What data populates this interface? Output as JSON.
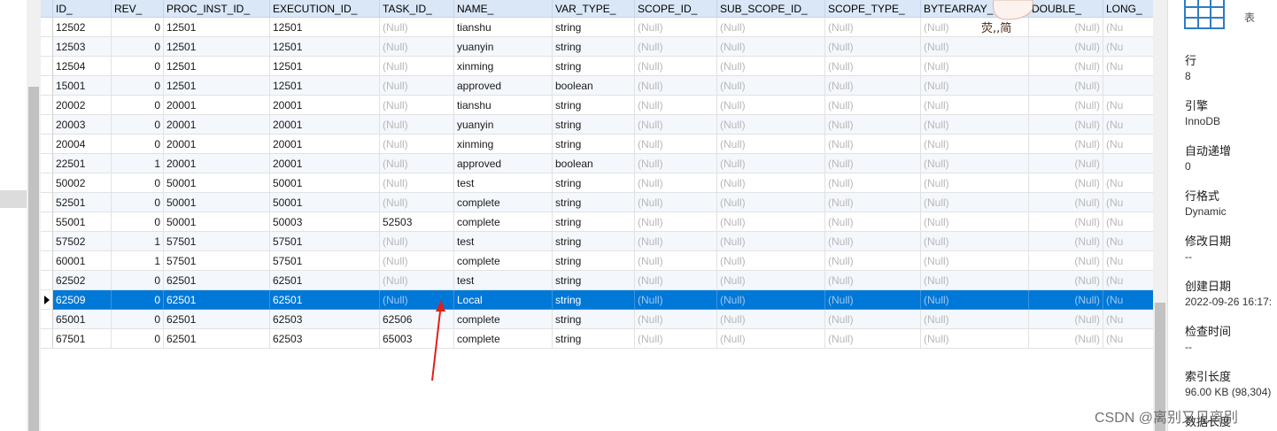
{
  "grid": {
    "columns": [
      "ID_",
      "REV_",
      "PROC_INST_ID_",
      "EXECUTION_ID_",
      "TASK_ID_",
      "NAME_",
      "VAR_TYPE_",
      "SCOPE_ID_",
      "SUB_SCOPE_ID_",
      "SCOPE_TYPE_",
      "BYTEARRAY_I",
      "DOUBLE_",
      "LONG_"
    ],
    "rows": [
      [
        "12502",
        "0",
        "12501",
        "12501",
        "(Null)",
        "tianshu",
        "string",
        "(Null)",
        "(Null)",
        "(Null)",
        "(Null)",
        "(Null)",
        "(Nu"
      ],
      [
        "12503",
        "0",
        "12501",
        "12501",
        "(Null)",
        "yuanyin",
        "string",
        "(Null)",
        "(Null)",
        "(Null)",
        "(Null)",
        "(Null)",
        "(Nu"
      ],
      [
        "12504",
        "0",
        "12501",
        "12501",
        "(Null)",
        "xinming",
        "string",
        "(Null)",
        "(Null)",
        "(Null)",
        "(Null)",
        "(Null)",
        "(Nu"
      ],
      [
        "15001",
        "0",
        "12501",
        "12501",
        "(Null)",
        "approved",
        "boolean",
        "(Null)",
        "(Null)",
        "(Null)",
        "(Null)",
        "(Null)",
        ""
      ],
      [
        "20002",
        "0",
        "20001",
        "20001",
        "(Null)",
        "tianshu",
        "string",
        "(Null)",
        "(Null)",
        "(Null)",
        "(Null)",
        "(Null)",
        "(Nu"
      ],
      [
        "20003",
        "0",
        "20001",
        "20001",
        "(Null)",
        "yuanyin",
        "string",
        "(Null)",
        "(Null)",
        "(Null)",
        "(Null)",
        "(Null)",
        "(Nu"
      ],
      [
        "20004",
        "0",
        "20001",
        "20001",
        "(Null)",
        "xinming",
        "string",
        "(Null)",
        "(Null)",
        "(Null)",
        "(Null)",
        "(Null)",
        "(Nu"
      ],
      [
        "22501",
        "1",
        "20001",
        "20001",
        "(Null)",
        "approved",
        "boolean",
        "(Null)",
        "(Null)",
        "(Null)",
        "(Null)",
        "(Null)",
        ""
      ],
      [
        "50002",
        "0",
        "50001",
        "50001",
        "(Null)",
        "test",
        "string",
        "(Null)",
        "(Null)",
        "(Null)",
        "(Null)",
        "(Null)",
        "(Nu"
      ],
      [
        "52501",
        "0",
        "50001",
        "50001",
        "(Null)",
        "complete",
        "string",
        "(Null)",
        "(Null)",
        "(Null)",
        "(Null)",
        "(Null)",
        "(Nu"
      ],
      [
        "55001",
        "0",
        "50001",
        "50003",
        "52503",
        "complete",
        "string",
        "(Null)",
        "(Null)",
        "(Null)",
        "(Null)",
        "(Null)",
        "(Nu"
      ],
      [
        "57502",
        "1",
        "57501",
        "57501",
        "(Null)",
        "test",
        "string",
        "(Null)",
        "(Null)",
        "(Null)",
        "(Null)",
        "(Null)",
        "(Nu"
      ],
      [
        "60001",
        "1",
        "57501",
        "57501",
        "(Null)",
        "complete",
        "string",
        "(Null)",
        "(Null)",
        "(Null)",
        "(Null)",
        "(Null)",
        "(Nu"
      ],
      [
        "62502",
        "0",
        "62501",
        "62501",
        "(Null)",
        "test",
        "string",
        "(Null)",
        "(Null)",
        "(Null)",
        "(Null)",
        "(Null)",
        "(Nu"
      ],
      [
        "62509",
        "0",
        "62501",
        "62501",
        "(Null)",
        "Local",
        "string",
        "(Null)",
        "(Null)",
        "(Null)",
        "(Null)",
        "(Null)",
        "(Nu"
      ],
      [
        "65001",
        "0",
        "62501",
        "62503",
        "62506",
        "complete",
        "string",
        "(Null)",
        "(Null)",
        "(Null)",
        "(Null)",
        "(Null)",
        "(Nu"
      ],
      [
        "67501",
        "0",
        "62501",
        "62503",
        "65003",
        "complete",
        "string",
        "(Null)",
        "(Null)",
        "(Null)",
        "(Null)",
        "(Null)",
        "(Nu"
      ]
    ],
    "selected_row": 14
  },
  "sticker": {
    "text": "荧,,简"
  },
  "side_panel": {
    "title": "表",
    "properties": [
      {
        "label": "行",
        "value": "8"
      },
      {
        "label": "引擎",
        "value": "InnoDB"
      },
      {
        "label": "自动递增",
        "value": "0"
      },
      {
        "label": "行格式",
        "value": "Dynamic"
      },
      {
        "label": "修改日期",
        "value": "--"
      },
      {
        "label": "创建日期",
        "value": "2022-09-26 16:17:"
      },
      {
        "label": "检查时间",
        "value": "--"
      },
      {
        "label": "索引长度",
        "value": "96.00 KB (98,304)"
      },
      {
        "label": "数据长度",
        "value": ""
      }
    ]
  },
  "watermark": "CSDN @离别又见离别",
  "colors": {
    "header_bg": "#d9e7f7",
    "selection_bg": "#0078d7",
    "null_text": "#b8b8b8",
    "annotation_arrow": "#e0201b"
  }
}
